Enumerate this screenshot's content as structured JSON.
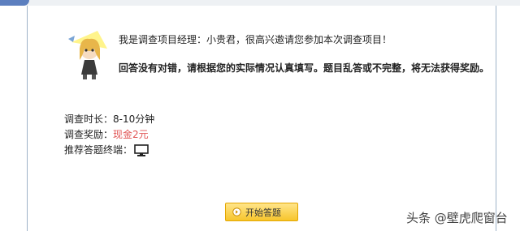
{
  "intro": {
    "greeting": "我是调查项目经理：小贵君，很高兴邀请您参加本次调查项目！",
    "notice": "回答没有对错，请根据您的实际情况认真填写。题目乱答或不完整，将无法获得奖励。"
  },
  "details": {
    "duration_label": "调查时长：",
    "duration_value": "8-10分钟",
    "reward_label": "调查奖励：",
    "reward_value": "现金2元",
    "terminal_label": "推荐答题终端：",
    "terminal_icon": "monitor-icon"
  },
  "actions": {
    "start_label": "开始答题",
    "start_icon": "arrow-right-circle-icon"
  },
  "watermark": "头条 @壁虎爬窗台",
  "colors": {
    "reward": "#e05252",
    "button": "#f7c52c",
    "panel_border": "#9fb3c8"
  }
}
